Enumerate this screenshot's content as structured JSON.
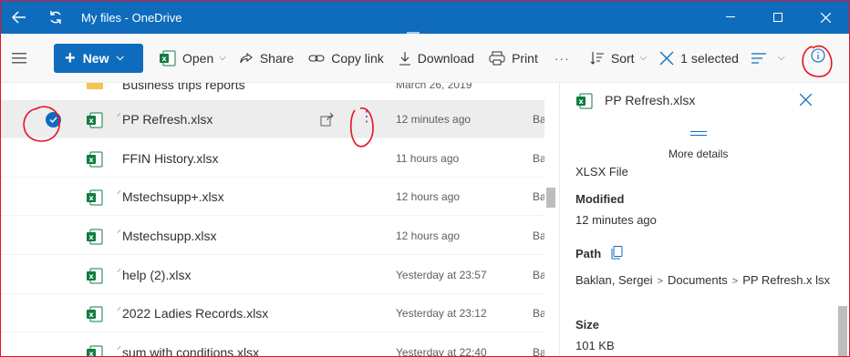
{
  "window": {
    "title": "My files - OneDrive",
    "controls": [
      "minimize",
      "maximize",
      "close"
    ]
  },
  "toolbar": {
    "new_label": "New",
    "open_label": "Open",
    "share_label": "Share",
    "copy_link_label": "Copy link",
    "download_label": "Download",
    "print_label": "Print",
    "more_label": "···",
    "sort_label": "Sort",
    "selected_label": "1 selected"
  },
  "files": [
    {
      "name": "Business trips reports",
      "modified": "March 26, 2019",
      "owner": "",
      "type": "folder",
      "selected": false,
      "is_new": false
    },
    {
      "name": "PP Refresh.xlsx",
      "modified": "12 minutes ago",
      "owner": "Ba",
      "type": "xlsx",
      "selected": true,
      "is_new": true
    },
    {
      "name": "FFIN History.xlsx",
      "modified": "11 hours ago",
      "owner": "Ba",
      "type": "xlsx",
      "selected": false,
      "is_new": false
    },
    {
      "name": "Mstechsupp+.xlsx",
      "modified": "12 hours ago",
      "owner": "Ba",
      "type": "xlsx",
      "selected": false,
      "is_new": true
    },
    {
      "name": "Mstechsupp.xlsx",
      "modified": "12 hours ago",
      "owner": "Ba",
      "type": "xlsx",
      "selected": false,
      "is_new": true
    },
    {
      "name": "help (2).xlsx",
      "modified": "Yesterday at 23:57",
      "owner": "Ba",
      "type": "xlsx",
      "selected": false,
      "is_new": true
    },
    {
      "name": "2022 Ladies Records.xlsx",
      "modified": "Yesterday at 23:12",
      "owner": "Ba",
      "type": "xlsx",
      "selected": false,
      "is_new": true
    },
    {
      "name": "sum with conditions.xlsx",
      "modified": "Yesterday at 22:40",
      "owner": "Ba",
      "type": "xlsx",
      "selected": false,
      "is_new": true
    }
  ],
  "details": {
    "title": "PP Refresh.xlsx",
    "more_details": "More details",
    "file_type": "XLSX File",
    "modified_label": "Modified",
    "modified_value": "12 minutes ago",
    "path_label": "Path",
    "path": [
      "Baklan, Sergei",
      "Documents",
      "PP Refresh.x lsx"
    ],
    "size_label": "Size",
    "size_value": "101 KB"
  },
  "colors": {
    "accent": "#0f6cbd",
    "excel": "#107c41",
    "annotation": "#e81123"
  }
}
